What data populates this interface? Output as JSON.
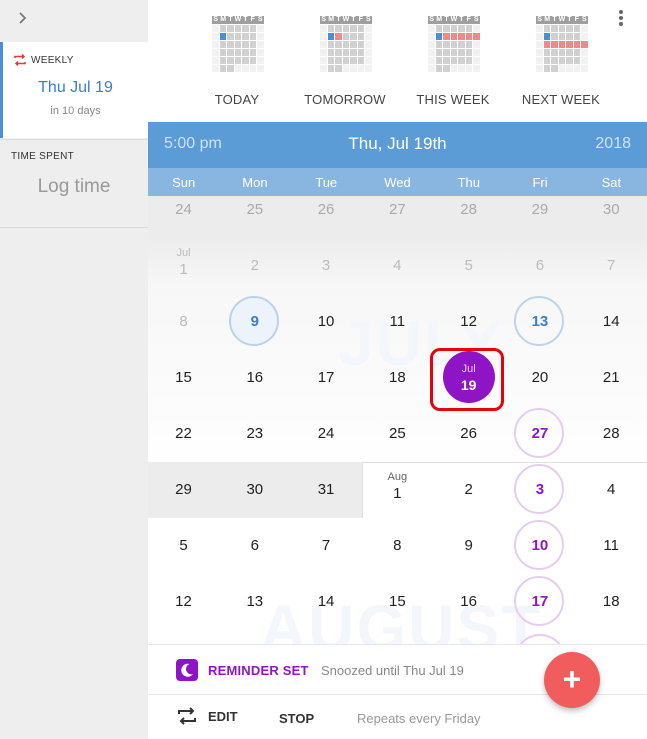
{
  "sidebar": {
    "weekly_label": "WEEKLY",
    "weekly_date": "Thu Jul 19",
    "weekly_relative": "in 10 days",
    "time_spent_label": "TIME SPENT",
    "log_time_label": "Log time"
  },
  "presets": [
    {
      "label": "TODAY",
      "day_letters": [
        "S",
        "M",
        "T",
        "W",
        "T",
        "F",
        "S"
      ]
    },
    {
      "label": "TOMORROW",
      "day_letters": [
        "S",
        "M",
        "T",
        "W",
        "T",
        "F",
        "S"
      ]
    },
    {
      "label": "THIS WEEK",
      "day_letters": [
        "S",
        "M",
        "T",
        "W",
        "T",
        "F",
        "S"
      ]
    },
    {
      "label": "NEXT WEEK",
      "day_letters": [
        "S",
        "M",
        "T",
        "W",
        "T",
        "F",
        "S"
      ]
    }
  ],
  "header": {
    "time": "5:00 pm",
    "date": "Thu, Jul 19th",
    "year": "2018"
  },
  "weekdays": [
    "Sun",
    "Mon",
    "Tue",
    "Wed",
    "Thu",
    "Fri",
    "Sat"
  ],
  "calendar": {
    "watermark_months": [
      "JULY",
      "AUGUST"
    ],
    "weeks": [
      [
        "24",
        "25",
        "26",
        "27",
        "28",
        "29",
        "30"
      ],
      [
        "1",
        "2",
        "3",
        "4",
        "5",
        "6",
        "7"
      ],
      [
        "8",
        "9",
        "10",
        "11",
        "12",
        "13",
        "14"
      ],
      [
        "15",
        "16",
        "17",
        "18",
        "19",
        "20",
        "21"
      ],
      [
        "22",
        "23",
        "24",
        "25",
        "26",
        "27",
        "28"
      ],
      [
        "29",
        "30",
        "31",
        "1",
        "2",
        "3",
        "4"
      ],
      [
        "5",
        "6",
        "7",
        "8",
        "9",
        "10",
        "11"
      ],
      [
        "12",
        "13",
        "14",
        "15",
        "16",
        "17",
        "18"
      ]
    ],
    "month_labels": {
      "jul": "Jul",
      "aug": "Aug",
      "selected": "Jul"
    },
    "today_day": "9",
    "selected_day": "19",
    "repeat_color": "#8e14c5",
    "accent_color": "#5b9bd6"
  },
  "reminder": {
    "status": "REMINDER SET",
    "snoozed_text": "Snoozed until Thu Jul 19",
    "moon_icon": "moon-icon"
  },
  "actions": {
    "edit_label": "EDIT",
    "stop_label": "STOP",
    "repeats_text": "Repeats every Friday",
    "fab_label": "+"
  }
}
